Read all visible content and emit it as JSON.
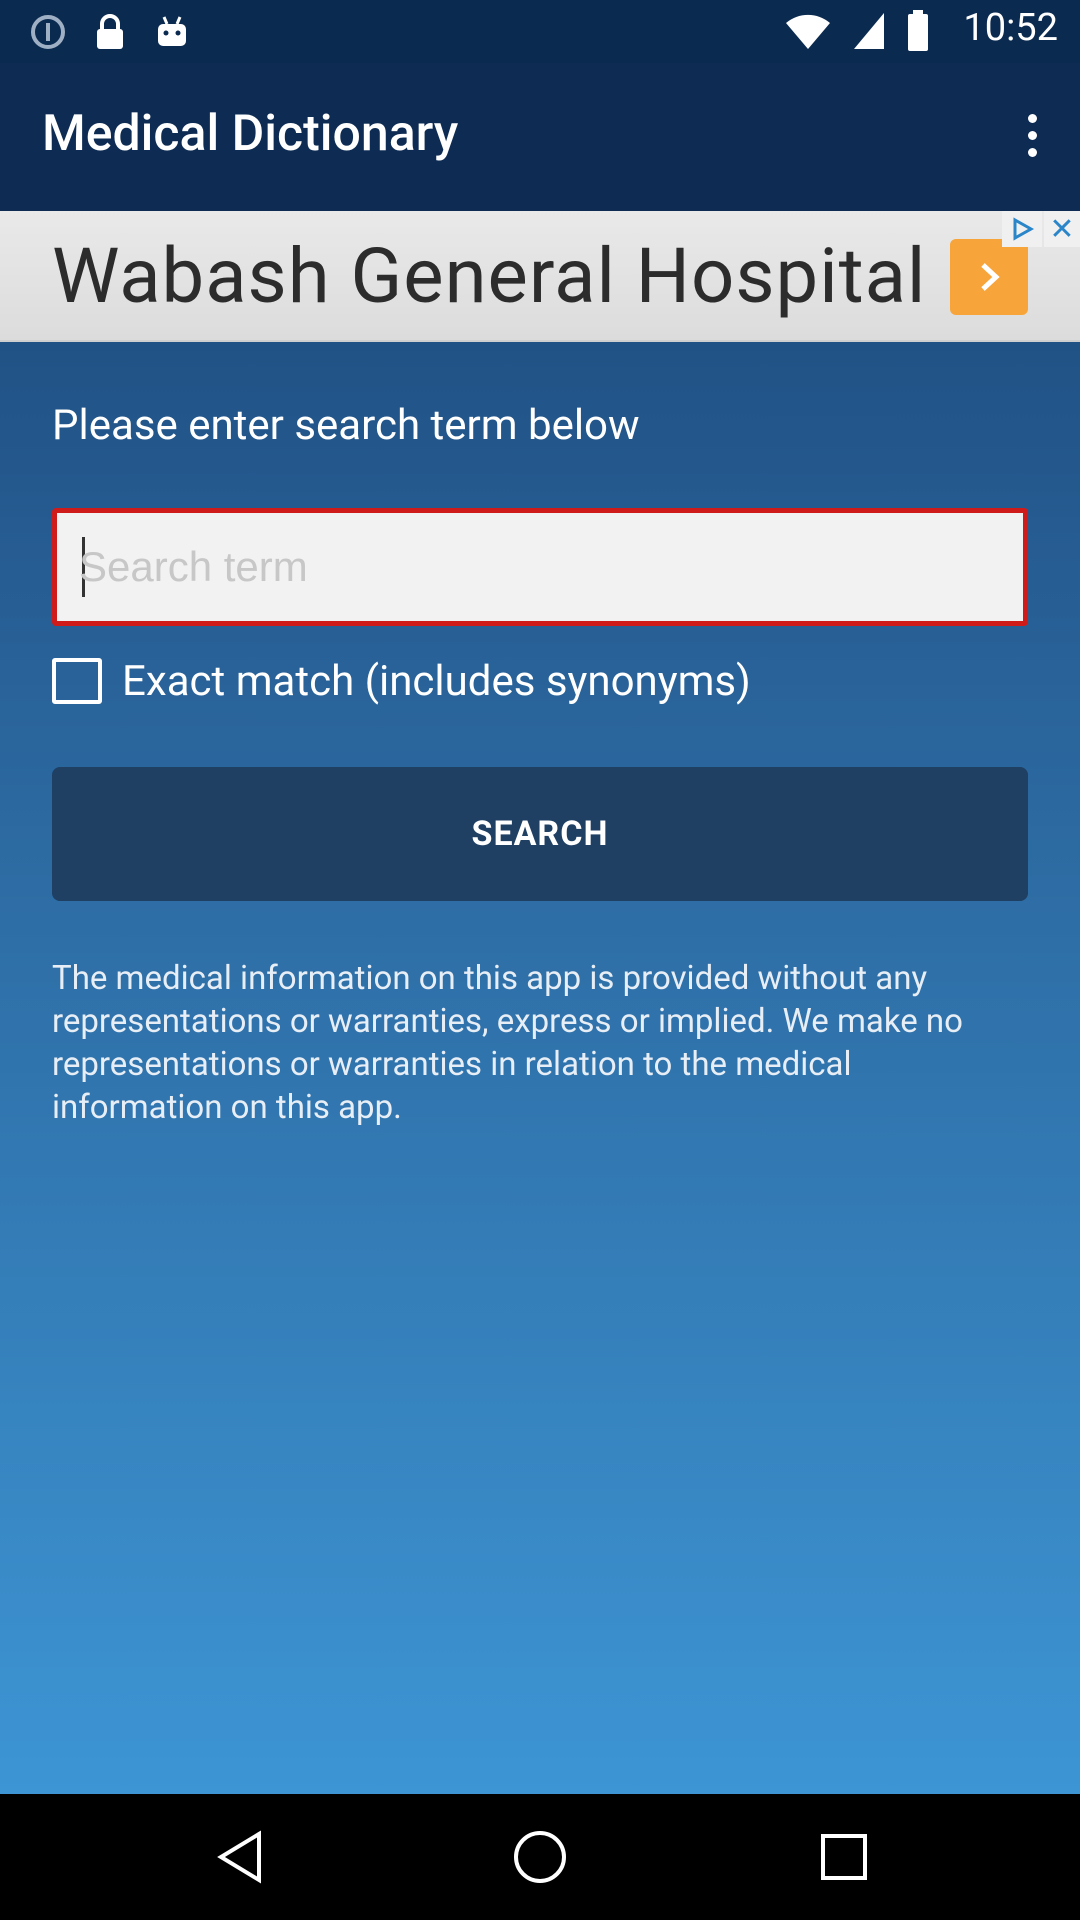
{
  "status_bar": {
    "time": "10:52",
    "left_icons": [
      "info-icon",
      "lock-icon",
      "android-icon"
    ],
    "right_icons": [
      "wifi-icon",
      "signal-icon",
      "battery-icon"
    ]
  },
  "app_bar": {
    "title": "Medical Dictionary",
    "overflow_icon": "more-vert-icon"
  },
  "ad": {
    "text": "Wabash General Hospital",
    "arrow_icon": "chevron-right-icon",
    "close_label": "✕"
  },
  "main": {
    "prompt": "Please enter search term below",
    "search_placeholder": "Search term",
    "search_value": "",
    "exact_match_label": "Exact match (includes synonyms)",
    "exact_match_checked": false,
    "search_button_label": "SEARCH",
    "disclaimer": "The medical information on this app is provided without any representations or warranties, express or implied. We make no representations or warranties in relation to the medical information on this app."
  },
  "colors": {
    "app_bar": "#0e2c53",
    "input_border": "#d01b1b",
    "button": "#1f3f63",
    "ad_arrow": "#f7a53a"
  }
}
